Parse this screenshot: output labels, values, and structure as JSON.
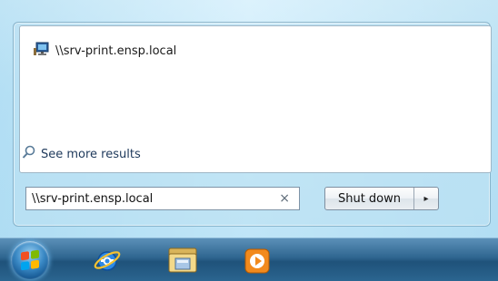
{
  "results": {
    "items": [
      {
        "label": "\\\\srv-print.ensp.local",
        "icon": "network-computer-icon"
      }
    ],
    "see_more": "See more results"
  },
  "search": {
    "value": "\\\\srv-print.ensp.local",
    "clear_glyph": "×"
  },
  "power": {
    "shutdown_label": "Shut down",
    "arrow_glyph": "▸"
  },
  "taskbar": {
    "start": "start-orb-icon",
    "pinned": [
      "internet-explorer-icon",
      "file-explorer-icon",
      "media-player-icon"
    ]
  },
  "colors": {
    "link": "#1e395b",
    "taskbar": "#2f6690",
    "accent_orange": "#f28a1d"
  }
}
